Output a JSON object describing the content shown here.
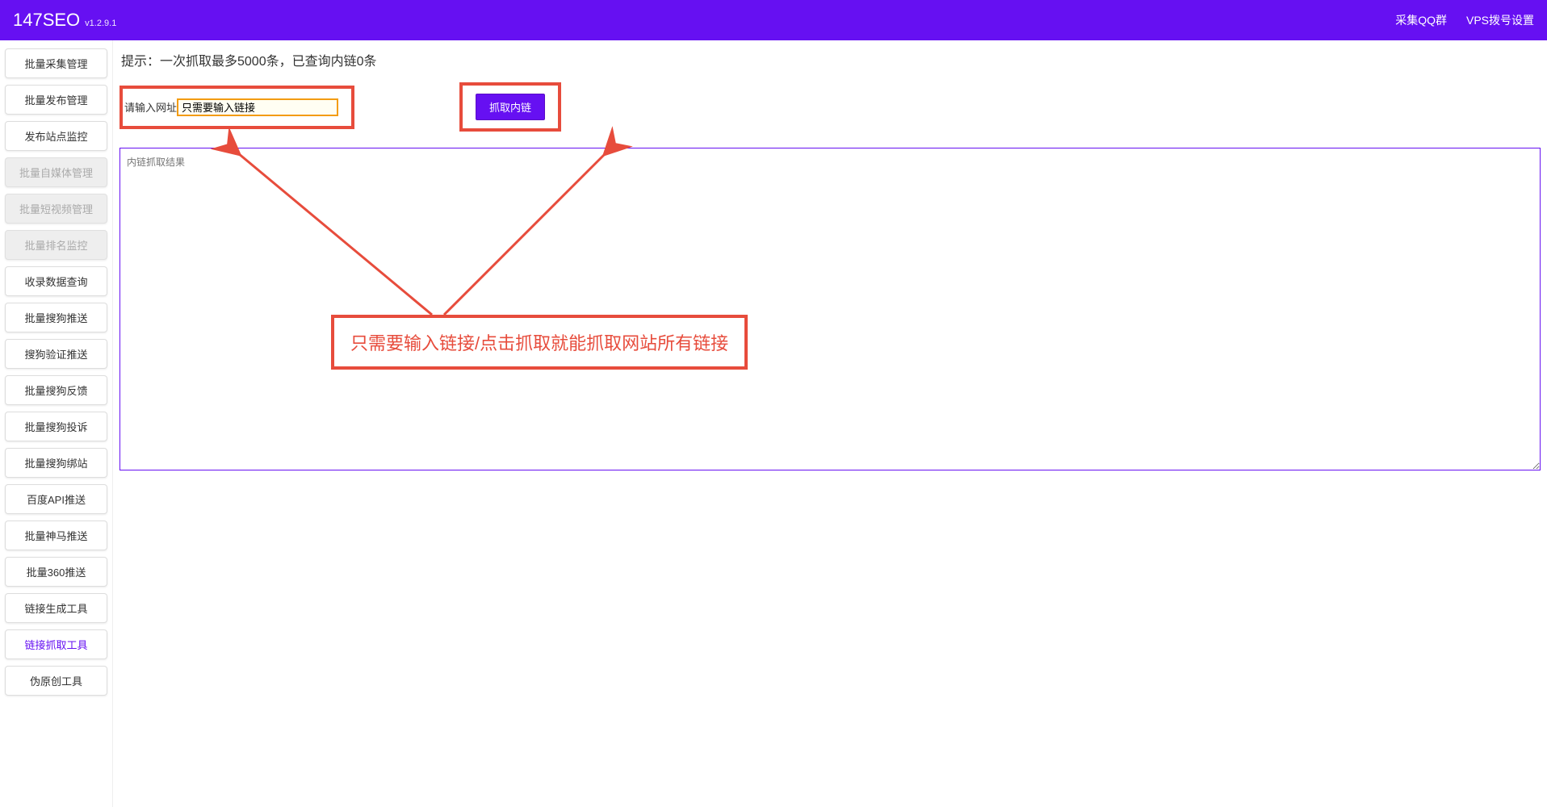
{
  "header": {
    "logo": "147SEO",
    "version": "v1.2.9.1",
    "links": {
      "qq_group": "采集QQ群",
      "vps_dial": "VPS拨号设置"
    }
  },
  "sidebar": {
    "items": [
      {
        "label": "批量采集管理",
        "disabled": false,
        "active": false
      },
      {
        "label": "批量发布管理",
        "disabled": false,
        "active": false
      },
      {
        "label": "发布站点监控",
        "disabled": false,
        "active": false
      },
      {
        "label": "批量自媒体管理",
        "disabled": true,
        "active": false
      },
      {
        "label": "批量短视频管理",
        "disabled": true,
        "active": false
      },
      {
        "label": "批量排名监控",
        "disabled": true,
        "active": false
      },
      {
        "label": "收录数据查询",
        "disabled": false,
        "active": false
      },
      {
        "label": "批量搜狗推送",
        "disabled": false,
        "active": false
      },
      {
        "label": "搜狗验证推送",
        "disabled": false,
        "active": false
      },
      {
        "label": "批量搜狗反馈",
        "disabled": false,
        "active": false
      },
      {
        "label": "批量搜狗投诉",
        "disabled": false,
        "active": false
      },
      {
        "label": "批量搜狗绑站",
        "disabled": false,
        "active": false
      },
      {
        "label": "百度API推送",
        "disabled": false,
        "active": false
      },
      {
        "label": "批量神马推送",
        "disabled": false,
        "active": false
      },
      {
        "label": "批量360推送",
        "disabled": false,
        "active": false
      },
      {
        "label": "链接生成工具",
        "disabled": false,
        "active": false
      },
      {
        "label": "链接抓取工具",
        "disabled": false,
        "active": true
      },
      {
        "label": "伪原创工具",
        "disabled": false,
        "active": false
      }
    ]
  },
  "main": {
    "hint": "提示：一次抓取最多5000条，已查询内链0条",
    "input_label": "请输入网址",
    "input_placeholder": "只需要输入链接",
    "input_value": "只需要输入链接",
    "fetch_button": "抓取内链",
    "result_placeholder": "内链抓取结果"
  },
  "annotation": {
    "text": "只需要输入链接/点击抓取就能抓取网站所有链接"
  },
  "colors": {
    "primary": "#6610f2",
    "annotation_red": "#e74c3c",
    "input_highlight": "#f39c12"
  }
}
